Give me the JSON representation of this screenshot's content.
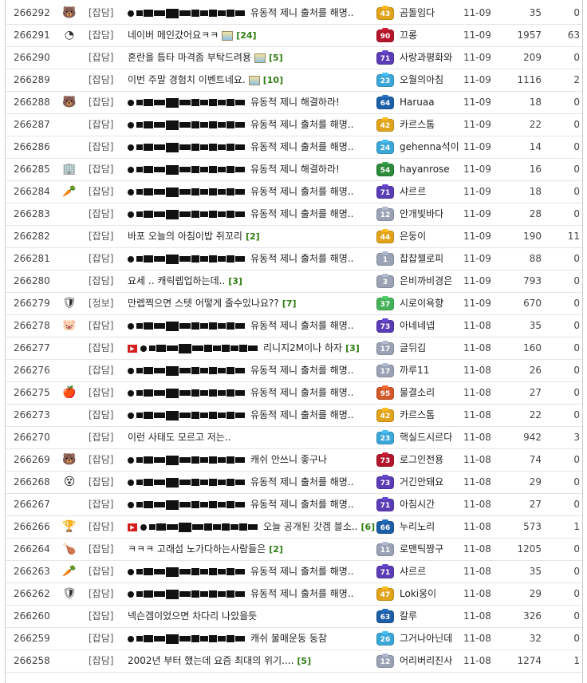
{
  "rows": [
    {
      "no": "266292",
      "icon_name": "bear-icon",
      "icon": "🐻",
      "cat": "[잡담]",
      "title": "유동적 제니 출처를 해명..",
      "redacted": true,
      "play": false,
      "img": false,
      "count": "",
      "level": "43",
      "level_color": "#e0a31a",
      "nick": "곰돌임다",
      "date": "11-09",
      "views": "35",
      "likes": "0"
    },
    {
      "no": "266291",
      "icon_name": "gauge-icon",
      "icon": "◔",
      "cat": "[잡담]",
      "title": "네이버 메인갔어요ㅋㅋ",
      "redacted": false,
      "play": false,
      "img": true,
      "count": "[24]",
      "level": "90",
      "level_color": "#b3162b",
      "nick": "끄롱",
      "date": "11-09",
      "views": "1957",
      "likes": "63"
    },
    {
      "no": "266290",
      "icon_name": "",
      "icon": "",
      "cat": "[잡담]",
      "title": "혼란을 틈타 마격좀 부탁드려용",
      "redacted": false,
      "play": false,
      "img": true,
      "count": "[5]",
      "level": "71",
      "level_color": "#5a3cb5",
      "nick": "사랑과평화와",
      "date": "11-09",
      "views": "209",
      "likes": "0"
    },
    {
      "no": "266289",
      "icon_name": "",
      "icon": "",
      "cat": "[잡담]",
      "title": "이번 주말 경험치 이벤트네요.",
      "redacted": false,
      "play": false,
      "img": true,
      "count": "[10]",
      "level": "23",
      "level_color": "#3aa7d8",
      "nick": "오월의아침",
      "date": "11-09",
      "views": "1116",
      "likes": "2"
    },
    {
      "no": "266288",
      "icon_name": "bear-icon",
      "icon": "🐻",
      "cat": "[잡담]",
      "title": "유동적 제니 해결하라!",
      "redacted": true,
      "play": false,
      "img": false,
      "count": "",
      "level": "64",
      "level_color": "#1d5ea8",
      "nick": "Haruaa",
      "date": "11-09",
      "views": "18",
      "likes": "0"
    },
    {
      "no": "266287",
      "icon_name": "",
      "icon": "",
      "cat": "[잡담]",
      "title": "유동적 제니 출처를 해명..",
      "redacted": true,
      "play": false,
      "img": false,
      "count": "",
      "level": "42",
      "level_color": "#e0a31a",
      "nick": "카르스톰",
      "date": "11-09",
      "views": "22",
      "likes": "0"
    },
    {
      "no": "266286",
      "icon_name": "",
      "icon": "",
      "cat": "[잡담]",
      "title": "유동적 제니 출처를 해명..",
      "redacted": true,
      "play": false,
      "img": false,
      "count": "",
      "level": "24",
      "level_color": "#3aa7d8",
      "nick": "gehenna석이",
      "date": "11-09",
      "views": "14",
      "likes": "0"
    },
    {
      "no": "266285",
      "icon_name": "building-icon",
      "icon": "🏢",
      "cat": "[잡담]",
      "title": "유동적 제니 해결하라!",
      "redacted": true,
      "play": false,
      "img": false,
      "count": "",
      "level": "54",
      "level_color": "#2c8a3a",
      "nick": "hayanrose",
      "date": "11-09",
      "views": "16",
      "likes": "0"
    },
    {
      "no": "266284",
      "icon_name": "carrot-icon",
      "icon": "🥕",
      "cat": "[잡담]",
      "title": "유동적 제니 출처를 해명..",
      "redacted": true,
      "play": false,
      "img": false,
      "count": "",
      "level": "71",
      "level_color": "#5a3cb5",
      "nick": "샤르르",
      "date": "11-09",
      "views": "18",
      "likes": "0"
    },
    {
      "no": "266283",
      "icon_name": "",
      "icon": "",
      "cat": "[잡담]",
      "title": "유동적 제니 출처를 해명..",
      "redacted": true,
      "play": false,
      "img": false,
      "count": "",
      "level": "12",
      "level_color": "#9aa3b5",
      "nick": "안개빛바다",
      "date": "11-09",
      "views": "28",
      "likes": "0"
    },
    {
      "no": "266282",
      "icon_name": "",
      "icon": "",
      "cat": "[잡담]",
      "title": "바포 오늘의 아침이밥 쥐꼬리",
      "redacted": false,
      "play": false,
      "img": false,
      "count": "[2]",
      "level": "44",
      "level_color": "#e0a31a",
      "nick": "은둥이",
      "date": "11-09",
      "views": "190",
      "likes": "11"
    },
    {
      "no": "266281",
      "icon_name": "",
      "icon": "",
      "cat": "[잡담]",
      "title": "유동적 제니 출처를 해명..",
      "redacted": true,
      "play": false,
      "img": false,
      "count": "",
      "level": "1",
      "level_color": "#9aa3b5",
      "nick": "찹찹젤로피",
      "date": "11-09",
      "views": "88",
      "likes": "0"
    },
    {
      "no": "266280",
      "icon_name": "",
      "icon": "",
      "cat": "[잡담]",
      "title": "요세 .. 캐릭렙업하는데..",
      "redacted": false,
      "play": false,
      "img": false,
      "count": "[3]",
      "level": "3",
      "level_color": "#9aa3b5",
      "nick": "은비까비경은",
      "date": "11-09",
      "views": "793",
      "likes": "0"
    },
    {
      "no": "266279",
      "icon_name": "shield-icon",
      "icon": "🛡",
      "cat": "[정보]",
      "title": "만렙찍으면 스텟 어떻게 줄수있나요??",
      "redacted": false,
      "play": false,
      "img": false,
      "count": "[7]",
      "level": "37",
      "level_color": "#45b25a",
      "nick": "시로이욕향",
      "date": "11-09",
      "views": "670",
      "likes": "0"
    },
    {
      "no": "266278",
      "icon_name": "pig-icon",
      "icon": "🐷",
      "cat": "[잡담]",
      "title": "유동적 제니 출처를 해명..",
      "redacted": true,
      "play": false,
      "img": false,
      "count": "",
      "level": "73",
      "level_color": "#5a3cb5",
      "nick": "아네네넵",
      "date": "11-08",
      "views": "35",
      "likes": "0"
    },
    {
      "no": "266277",
      "icon_name": "",
      "icon": "",
      "cat": "[잡담]",
      "title": "리니지2M이나 하자",
      "redacted": true,
      "play": true,
      "img": false,
      "count": "[3]",
      "level": "17",
      "level_color": "#9aa3b5",
      "nick": "글뒤김",
      "date": "11-08",
      "views": "160",
      "likes": "0"
    },
    {
      "no": "266276",
      "icon_name": "",
      "icon": "",
      "cat": "[잡담]",
      "title": "유동적 제니 출처를 해명..",
      "redacted": true,
      "play": false,
      "img": false,
      "count": "",
      "level": "17",
      "level_color": "#9aa3b5",
      "nick": "까루11",
      "date": "11-08",
      "views": "26",
      "likes": "0"
    },
    {
      "no": "266275",
      "icon_name": "apple-icon",
      "icon": "🍎",
      "cat": "[잡담]",
      "title": "유동적 제니 출처를 해명..",
      "redacted": true,
      "play": false,
      "img": false,
      "count": "",
      "level": "95",
      "level_color": "#d4582a",
      "nick": "물결소리",
      "date": "11-08",
      "views": "27",
      "likes": "0"
    },
    {
      "no": "266273",
      "icon_name": "",
      "icon": "",
      "cat": "[잡담]",
      "title": "유동적 제니 출처를 해명..",
      "redacted": true,
      "play": false,
      "img": false,
      "count": "",
      "level": "42",
      "level_color": "#e0a31a",
      "nick": "카르스톰",
      "date": "11-08",
      "views": "22",
      "likes": "0"
    },
    {
      "no": "266270",
      "icon_name": "",
      "icon": "",
      "cat": "[잡담]",
      "title": "이런 사태도 모르고 저는..",
      "redacted": false,
      "play": false,
      "img": false,
      "count": "",
      "level": "23",
      "level_color": "#3aa7d8",
      "nick": "핵실드시르다",
      "date": "11-08",
      "views": "942",
      "likes": "3"
    },
    {
      "no": "266269",
      "icon_name": "bear-icon",
      "icon": "🐻",
      "cat": "[잡담]",
      "title": "캐쉬 안쓰니 좋구나",
      "redacted": true,
      "play": false,
      "img": false,
      "count": "",
      "level": "73",
      "level_color": "#b3162b",
      "nick": "로그인전용",
      "date": "11-08",
      "views": "74",
      "likes": "0"
    },
    {
      "no": "266268",
      "icon_name": "face-icon",
      "icon": "😵",
      "cat": "[잡담]",
      "title": "유동적 제니 출처를 해명..",
      "redacted": true,
      "play": false,
      "img": false,
      "count": "",
      "level": "73",
      "level_color": "#5a3cb5",
      "nick": "거긴안돼요",
      "date": "11-08",
      "views": "29",
      "likes": "0"
    },
    {
      "no": "266267",
      "icon_name": "",
      "icon": "",
      "cat": "[잡담]",
      "title": "유동적 제니 출처를 해명..",
      "redacted": true,
      "play": false,
      "img": false,
      "count": "",
      "level": "71",
      "level_color": "#5a3cb5",
      "nick": "아침시간",
      "date": "11-08",
      "views": "27",
      "likes": "0"
    },
    {
      "no": "266266",
      "icon_name": "trophy-icon",
      "icon": "🏆",
      "cat": "[잡담]",
      "title": "오늘 공개된 갓겜 블소..",
      "redacted": true,
      "play": true,
      "img": false,
      "count": "[6]",
      "level": "66",
      "level_color": "#1d5ea8",
      "nick": "누리노리",
      "date": "11-08",
      "views": "573",
      "likes": "1"
    },
    {
      "no": "266264",
      "icon_name": "drumstick-icon",
      "icon": "🍗",
      "cat": "[잡담]",
      "title": "ㅋㅋㅋ 고래섬 노가다하는사람들은",
      "redacted": false,
      "play": false,
      "img": false,
      "count": "[2]",
      "level": "11",
      "level_color": "#9aa3b5",
      "nick": "로맨틱짱구",
      "date": "11-08",
      "views": "1205",
      "likes": "0"
    },
    {
      "no": "266263",
      "icon_name": "carrot-icon",
      "icon": "🥕",
      "cat": "[잡담]",
      "title": "유동적 제니 출처를 해명..",
      "redacted": true,
      "play": false,
      "img": false,
      "count": "",
      "level": "71",
      "level_color": "#5a3cb5",
      "nick": "샤르르",
      "date": "11-08",
      "views": "35",
      "likes": "0"
    },
    {
      "no": "266262",
      "icon_name": "shield-icon",
      "icon": "🛡",
      "cat": "[잡담]",
      "title": "유동적 제니 출처를 해명..",
      "redacted": true,
      "play": false,
      "img": false,
      "count": "",
      "level": "47",
      "level_color": "#e0a31a",
      "nick": "Loki웅이",
      "date": "11-08",
      "views": "29",
      "likes": "0"
    },
    {
      "no": "266260",
      "icon_name": "",
      "icon": "",
      "cat": "[잡담]",
      "title": "넥슨겜이었으면 차다리 나았을듯",
      "redacted": false,
      "play": false,
      "img": false,
      "count": "",
      "level": "63",
      "level_color": "#1d5ea8",
      "nick": "칼루",
      "date": "11-08",
      "views": "326",
      "likes": "0"
    },
    {
      "no": "266259",
      "icon_name": "",
      "icon": "",
      "cat": "[잡담]",
      "title": "캐쉬 불매운동 동참",
      "redacted": true,
      "play": false,
      "img": false,
      "count": "",
      "level": "26",
      "level_color": "#3aa7d8",
      "nick": "그거나아닌데",
      "date": "11-08",
      "views": "32",
      "likes": "0"
    },
    {
      "no": "266258",
      "icon_name": "",
      "icon": "",
      "cat": "[잡담]",
      "title": "2002년 부터 했는데 요즘 최대의 위기....",
      "redacted": false,
      "play": false,
      "img": false,
      "count": "[5]",
      "level": "12",
      "level_color": "#9aa3b5",
      "nick": "어리버리진사",
      "date": "11-08",
      "views": "1274",
      "likes": "1"
    }
  ]
}
